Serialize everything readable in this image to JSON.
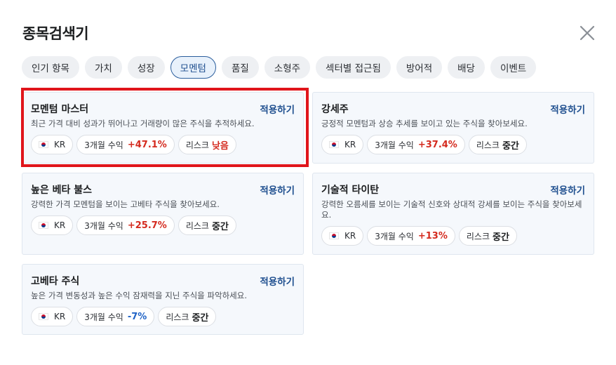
{
  "title": "종목검색기",
  "tabs": [
    {
      "label": "인기 항목"
    },
    {
      "label": "가치"
    },
    {
      "label": "성장"
    },
    {
      "label": "모멘텀",
      "active": true
    },
    {
      "label": "품질"
    },
    {
      "label": "소형주"
    },
    {
      "label": "섹터별 접근됨"
    },
    {
      "label": "방어적"
    },
    {
      "label": "배당"
    },
    {
      "label": "이벤트"
    }
  ],
  "apply_label": "적용하기",
  "return_prefix": "3개월 수익",
  "risk_prefix": "리스크",
  "colors": {
    "accent": "#1f4f8f",
    "positive": "#d42a1e",
    "negative": "#1f63c6",
    "highlight": "#e0151b"
  },
  "cards": [
    {
      "title": "모멘텀 마스터",
      "desc": "최근 가격 대비 성과가 뛰어나고 거래량이 많은 주식을 추적하세요.",
      "market": "KR",
      "return": "+47.1%",
      "risk": "낮음"
    },
    {
      "title": "강세주",
      "desc": "긍정적 모멘텀과 상승 추세를 보이고 있는 주식을 찾아보세요.",
      "market": "KR",
      "return": "+37.4%",
      "risk": "중간"
    },
    {
      "title": "높은 베타 불스",
      "desc": "강력한 가격 모멘텀을 보이는 고베타 주식을 찾아보세요.",
      "market": "KR",
      "return": "+25.7%",
      "risk": "중간"
    },
    {
      "title": "기술적 타이탄",
      "desc": "강력한 오름세를 보이는 기술적 신호와 상대적 강세를 보이는 주식을 찾아보세요.",
      "market": "KR",
      "return": "+13%",
      "risk": "중간"
    },
    {
      "title": "고베타 주식",
      "desc": "높은 가격 변동성과 높은 수익 잠재력을 지닌 주식을 파악하세요.",
      "market": "KR",
      "return": "-7%",
      "risk": "중간"
    }
  ]
}
